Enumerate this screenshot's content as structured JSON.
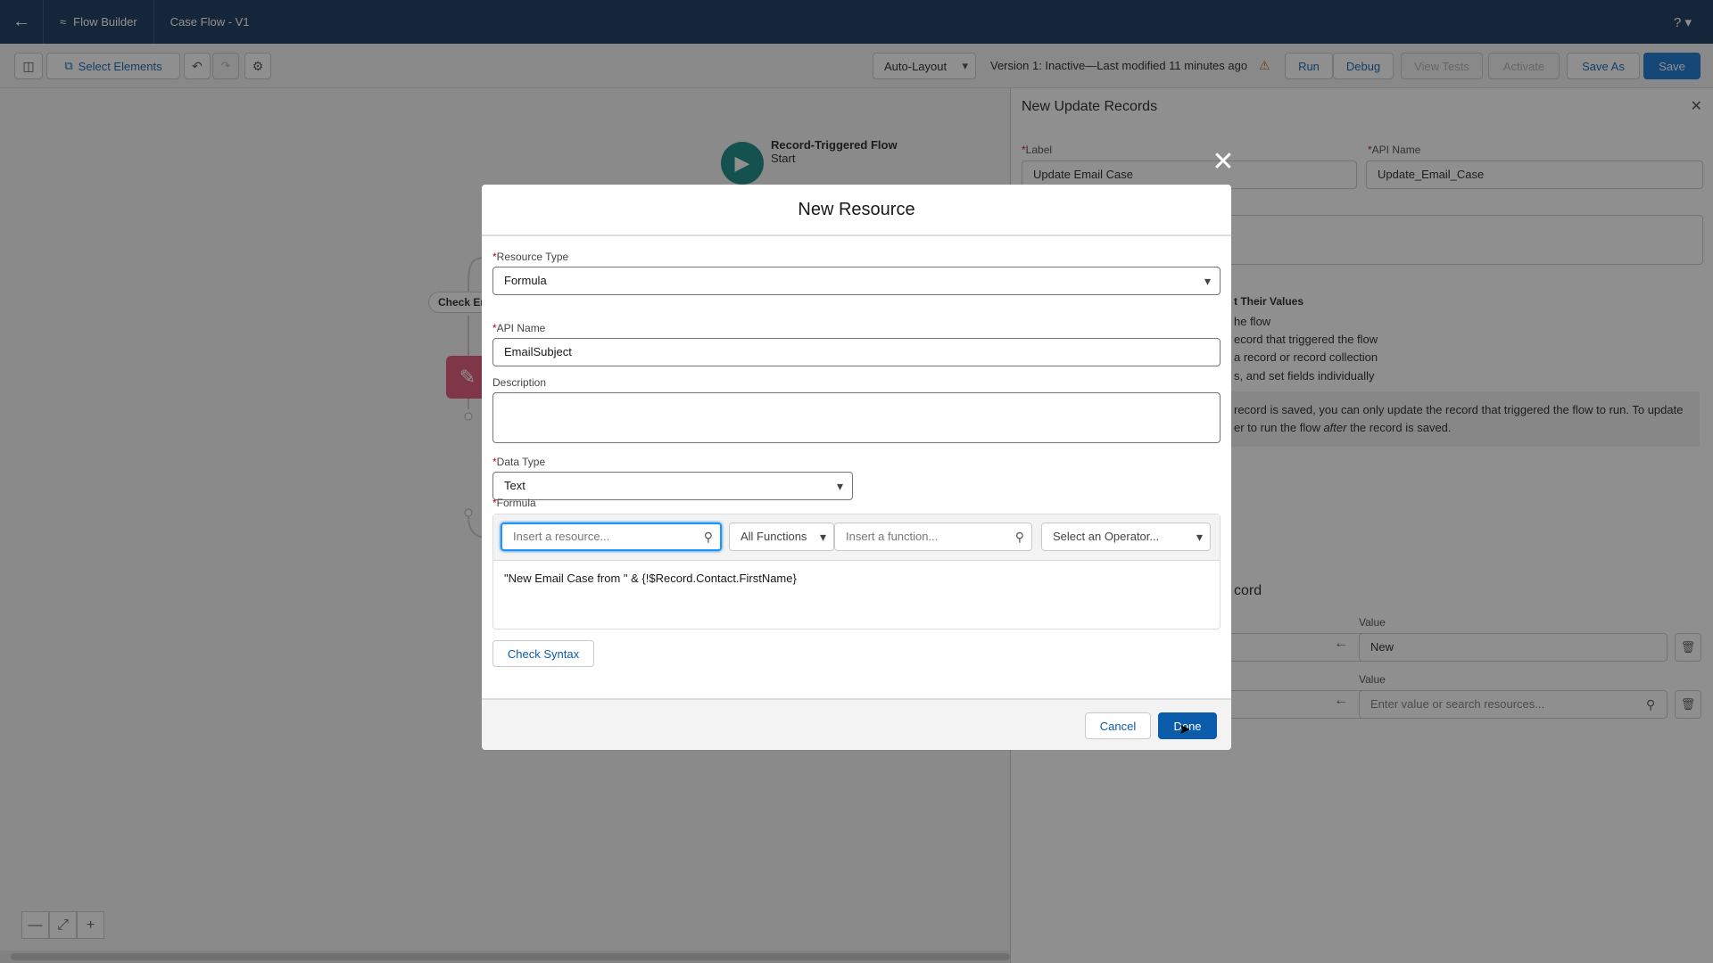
{
  "header": {
    "app_name": "Flow Builder",
    "flow_name": "Case Flow - V1",
    "help": "? ▾"
  },
  "toolbar": {
    "select_elements": "Select Elements",
    "auto_layout": "Auto-Layout",
    "status": "Version 1: Inactive—Last modified 11 minutes ago",
    "run": "Run",
    "debug": "Debug",
    "view_tests": "View Tests",
    "activate": "Activate",
    "save_as": "Save As",
    "save": "Save"
  },
  "canvas": {
    "start_title": "Record-Triggered Flow",
    "start_sub": "Start",
    "check_label": "Check En"
  },
  "panel": {
    "title": "New Update Records",
    "label_label": "Label",
    "label_value": "Update Email Case",
    "api_label": "API Name",
    "api_value": "Update_Email_Case",
    "section_heading": "t Their Values",
    "opt1": "he flow",
    "opt2": "ecord that triggered the flow",
    "opt3": " a record or record collection",
    "opt4": "s, and set fields individually",
    "info1": "record is saved, you can only update the record that triggered the flow to run. To update",
    "info2_pre": "er to run the flow ",
    "info2_em": "after",
    "info2_post": " the record is saved.",
    "record_heading": "cord",
    "value_label_1": "Value",
    "value_1": "New",
    "value_label_2": "Value",
    "value_2_placeholder": "Enter value or search resources..."
  },
  "modal": {
    "title": "New Resource",
    "resource_type_label": "Resource Type",
    "resource_type": "Formula",
    "api_name_label": "API Name",
    "api_name": "EmailSubject",
    "description_label": "Description",
    "data_type_label": "Data Type",
    "data_type": "Text",
    "formula_label": "Formula",
    "insert_resource_placeholder": "Insert a resource...",
    "all_functions": "All Functions",
    "insert_function_placeholder": "Insert a function...",
    "select_operator": "Select an Operator...",
    "formula": "\"New Email Case from \" & {!$Record.Contact.FirstName}",
    "check_syntax": "Check Syntax",
    "cancel": "Cancel",
    "done": "Done"
  }
}
